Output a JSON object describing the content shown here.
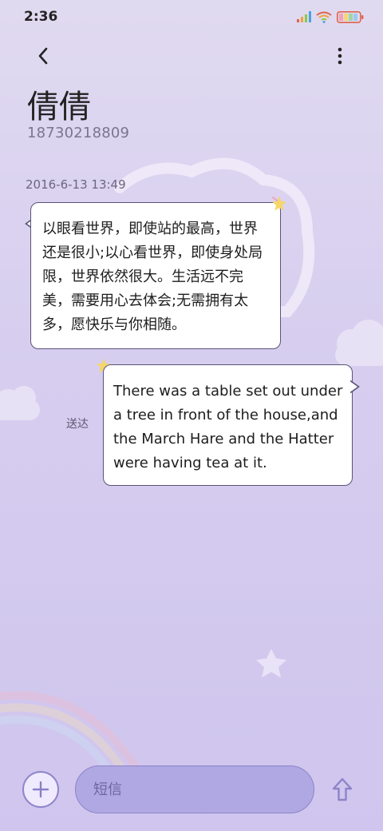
{
  "status_bar": {
    "time": "2:36"
  },
  "icons": {
    "back": "chevron-left-icon",
    "more": "more-vert-icon",
    "add": "plus-circle-icon",
    "send": "arrow-up-icon",
    "signal": "signal-icon",
    "wifi": "wifi-icon",
    "battery": "battery-icon"
  },
  "contact": {
    "name": "倩倩",
    "number": "18730218809"
  },
  "conversation": {
    "timestamp": "2016-6-13 13:49",
    "messages": [
      {
        "direction": "incoming",
        "text": "以眼看世界，即使站的最高，世界还是很小;以心看世界，即使身处局限，世界依然很大。生活远不完美，需要用心去体会;无需拥有太多，愿快乐与你相随。"
      },
      {
        "direction": "outgoing",
        "text": "There was a table set out under a tree in front of the house,and the March Hare and the Hatter were having tea at it.",
        "status": "送达"
      }
    ]
  },
  "composer": {
    "placeholder": "短信"
  },
  "colors": {
    "background": "#d6cdef",
    "bubble": "#ffffff",
    "bubble_border": "#5a5478",
    "input_fill": "#b0a8e2",
    "accent": "#8f86c9"
  }
}
